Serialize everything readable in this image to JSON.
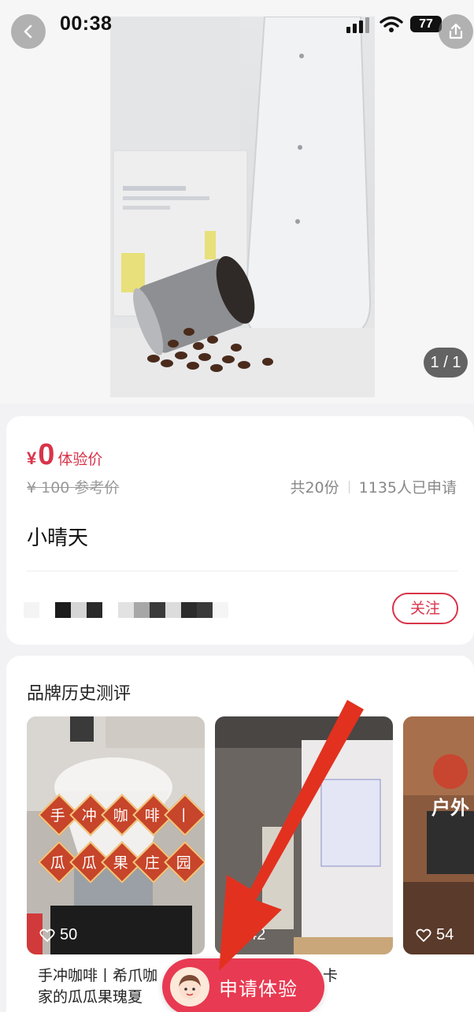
{
  "status_bar": {
    "time": "00:38",
    "battery": "77"
  },
  "hero": {
    "page_indicator": "1 / 1"
  },
  "product": {
    "price_symbol": "¥",
    "price_value": "0",
    "price_label": "体验价",
    "reference_price": "¥ 100 参考价",
    "total_count": "共20份",
    "applicants": "1135人已申请",
    "shop_name": "小晴天",
    "follow_label": "关注"
  },
  "reviews": {
    "title": "品牌历史测评",
    "items": [
      {
        "likes": "50",
        "title_line1": "手冲咖啡丨希爪咖",
        "title_line2": "家的瓜瓜果瑰夏",
        "overlay_row1": [
          "手",
          "冲",
          "咖",
          "啡",
          "丨"
        ],
        "overlay_row2": [
          "瓜",
          "瓜",
          "果",
          "庄",
          "园"
        ]
      },
      {
        "likes": "42",
        "title_line1": "卡",
        "title_line2": ""
      },
      {
        "likes": "54",
        "overlay_text": "户外"
      }
    ]
  },
  "apply_button": {
    "label": "申请体验"
  },
  "colors": {
    "accent": "#e83a52",
    "price": "#d8344a",
    "arrow": "#e2311f"
  }
}
